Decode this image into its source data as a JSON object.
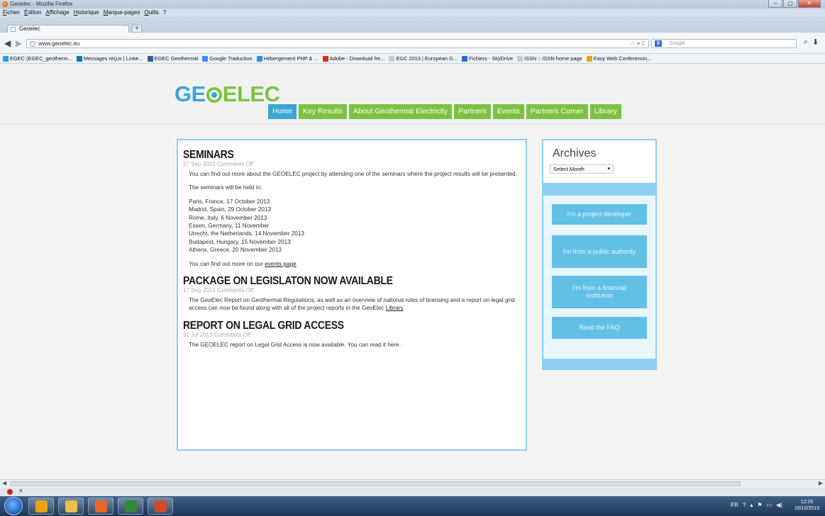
{
  "window": {
    "title": "Geoelec - Mozilla Firefox",
    "buttons": [
      "–",
      "▢",
      "✕"
    ]
  },
  "menu": [
    "Fichier",
    "Édition",
    "Affichage",
    "Historique",
    "Marque-pages",
    "Outils",
    "?"
  ],
  "tab": {
    "title": "Geoelec",
    "new_tab": "+"
  },
  "navbar": {
    "url": "www.geoelec.eu",
    "url_right": "☆ ▾ C",
    "search_placeholder": "Google",
    "search_engine": "8"
  },
  "bookmarks": [
    {
      "label": "EGEC (EGEC_geotherm...",
      "icon_color": "#1da1f2"
    },
    {
      "label": "Messages reçus | Linke...",
      "icon_color": "#0e76a8"
    },
    {
      "label": "EGEC Geothermal",
      "icon_color": "#3b5998"
    },
    {
      "label": "Google Traduction",
      "icon_color": "#4285f4"
    },
    {
      "label": "Hébergement PHP & ...",
      "icon_color": "#2e8fd6"
    },
    {
      "label": "Adobe - Download fre...",
      "icon_color": "#e3281b"
    },
    {
      "label": "EGC 2013 | European G...",
      "icon_color": "#cccccc"
    },
    {
      "label": "Fichiers - SkyDrive",
      "icon_color": "#1e6fd9"
    },
    {
      "label": "ISSN :: ISSN home page",
      "icon_color": "#cccccc"
    },
    {
      "label": "Easy Web Conferencin...",
      "icon_color": "#e8a214"
    }
  ],
  "site": {
    "logo_left": "GE",
    "logo_right": "ELEC",
    "nav": [
      "Home",
      "Key Results",
      "About Geothermal Electricity",
      "Partners",
      "Events",
      "Partners Corner",
      "Library"
    ]
  },
  "posts": {
    "p1": {
      "title": "SEMINARS",
      "meta": "27 Sep 2013 Comments Off",
      "intro": "You can find out more about the GEOELEC project by attending one of the seminars where the project results will be presented.",
      "held": "The seminars will be held in:",
      "cities": [
        "Paris, France, 17 October 2013",
        "Madrid, Spain, 29 October 2013",
        "Rome, Italy, 6 November 2013",
        "Essen, Germany, 11 November",
        "Utrecht, the Netherlands, 14 November 2013",
        "Budapest, Hungary, 15 November 2013",
        "Athens, Greece, 20 November 2013"
      ],
      "more_prefix": "You can find out more on our ",
      "more_link": "events page"
    },
    "p2": {
      "title": "PACKAGE ON LEGISLATON NOW AVAILABLE",
      "meta": "17 Sep 2013 Comments Off",
      "body": "The GeoElec Report on Geothermal Regulations, as well as an overview of  national rules of licensing and a report on legal grid access can now be found along with all of the project reports in the GeoElec ",
      "link": "Library"
    },
    "p3": {
      "title": "REPORT ON LEGAL GRID ACCESS",
      "meta": "31 Jul 2013 Comments Off",
      "body": "The GEOELEC report on Legal Grid Access is now available. You can read it here."
    }
  },
  "sidebar": {
    "archives_title": "Archives",
    "select_value": "Select Month",
    "buttons": [
      "I'm a project developer",
      "I'm from a public authority",
      "I'm from a financial institution",
      "Read the FAQ"
    ]
  },
  "taskbar": {
    "tray_lang": "FR",
    "time": "12:25",
    "date": "16/10/2013",
    "apps": [
      {
        "name": "outlook",
        "color": "#e8a214"
      },
      {
        "name": "explorer",
        "color": "#e8c14a"
      },
      {
        "name": "firefox",
        "color": "#e8662a"
      },
      {
        "name": "excel",
        "color": "#2f8a3c"
      },
      {
        "name": "powerpoint",
        "color": "#d24726"
      }
    ]
  }
}
